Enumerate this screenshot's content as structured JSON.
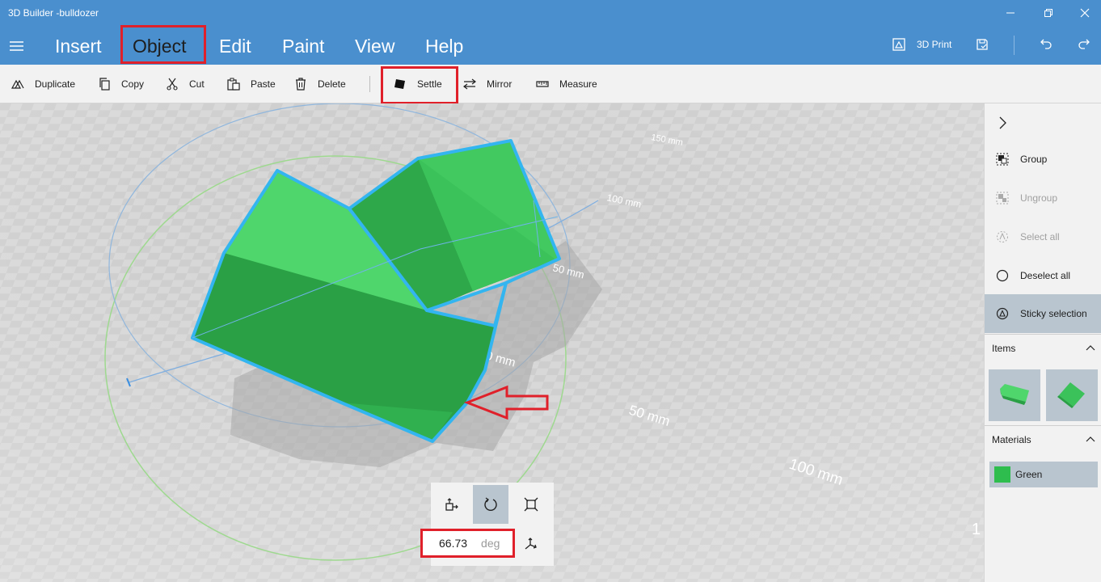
{
  "window": {
    "title": "3D Builder -bulldozer"
  },
  "menu": {
    "items": [
      "Insert",
      "Object",
      "Edit",
      "Paint",
      "View",
      "Help"
    ],
    "active": "Object",
    "print_label": "3D Print"
  },
  "toolbar": {
    "duplicate": "Duplicate",
    "copy": "Copy",
    "cut": "Cut",
    "paste": "Paste",
    "delete": "Delete",
    "settle": "Settle",
    "mirror": "Mirror",
    "measure": "Measure"
  },
  "viewport": {
    "grid_labels": [
      "150 mm",
      "100 mm",
      "50 mm",
      "0 mm",
      "50 mm",
      "100 mm",
      "1"
    ],
    "object_color": "#3cc45a",
    "selection_color": "#33b5f0"
  },
  "manipulator": {
    "rotation_value": "66.73",
    "rotation_unit": "deg"
  },
  "right_panel": {
    "group": "Group",
    "ungroup": "Ungroup",
    "select_all": "Select all",
    "deselect_all": "Deselect all",
    "sticky_selection": "Sticky selection",
    "items_header": "Items",
    "materials_header": "Materials",
    "material_name": "Green",
    "material_color": "#2ebd4e"
  }
}
